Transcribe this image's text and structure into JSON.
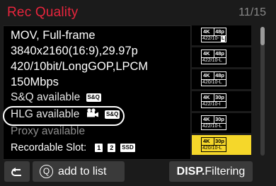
{
  "header": {
    "title": "Rec Quality",
    "page_indicator": "11/15"
  },
  "detail": {
    "format": "MOV, Full-frame",
    "resolution": "3840x2160(16:9),29.97p",
    "codec": "420/10bit/LongGOP,LPCM",
    "bitrate": "150Mbps",
    "sq_available": "S&Q available",
    "sq_badge": "S&Q",
    "hlg_available": "HLG available",
    "hlg_sq_badge": "S&Q",
    "proxy_available": "Proxy available",
    "recordable_slot": "Recordable Slot:",
    "slot1": "1",
    "slot2": "2",
    "slot_ssd": "SSD"
  },
  "list": {
    "items": [
      {
        "res": "4K",
        "fps": "48p",
        "fmt": "422/10-",
        "flag": "L",
        "selected": false
      },
      {
        "res": "4K",
        "fps": "48p",
        "fmt": "422/10-L",
        "flag": "",
        "selected": false
      },
      {
        "res": "4K",
        "fps": "48p",
        "fmt": "420/10-L",
        "flag": "",
        "selected": false
      },
      {
        "res": "4K",
        "fps": "30p",
        "fmt": "422/10-I",
        "flag": "",
        "selected": false
      },
      {
        "res": "4K",
        "fps": "30p",
        "fmt": "422/10-L",
        "flag": "",
        "selected": false
      },
      {
        "res": "4K",
        "fps": "30p",
        "fmt": "420/10-L",
        "flag": "",
        "selected": true
      }
    ]
  },
  "footer": {
    "back_icon": "return-arrow-icon",
    "q_label": "Q",
    "add_to_list": "add to list",
    "disp_label": "DISP.",
    "filtering_label": "Filtering"
  },
  "colors": {
    "title": "#e8253d",
    "selected_bg": "#f5d72a"
  }
}
